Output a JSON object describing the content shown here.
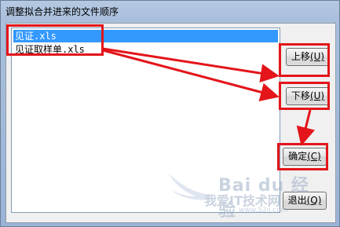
{
  "window": {
    "title": "调整拟合并进来的文件顺序"
  },
  "files": [
    "见证.xls",
    "见证取样单.xls"
  ],
  "buttons": {
    "up": {
      "label": "上移",
      "accel": "(U)"
    },
    "down": {
      "label": "下移",
      "accel": "(U)"
    },
    "ok": {
      "label": "确定",
      "accel": "(C)"
    },
    "exit": {
      "label": "退出",
      "accel": "(Q)"
    }
  },
  "watermark": {
    "brand": "Bai du 经验",
    "slogan": "我爱IT技术网",
    "url": "www.52ij.com"
  },
  "colors": {
    "annotation": "#e3151a",
    "selection": "#3399ff"
  }
}
